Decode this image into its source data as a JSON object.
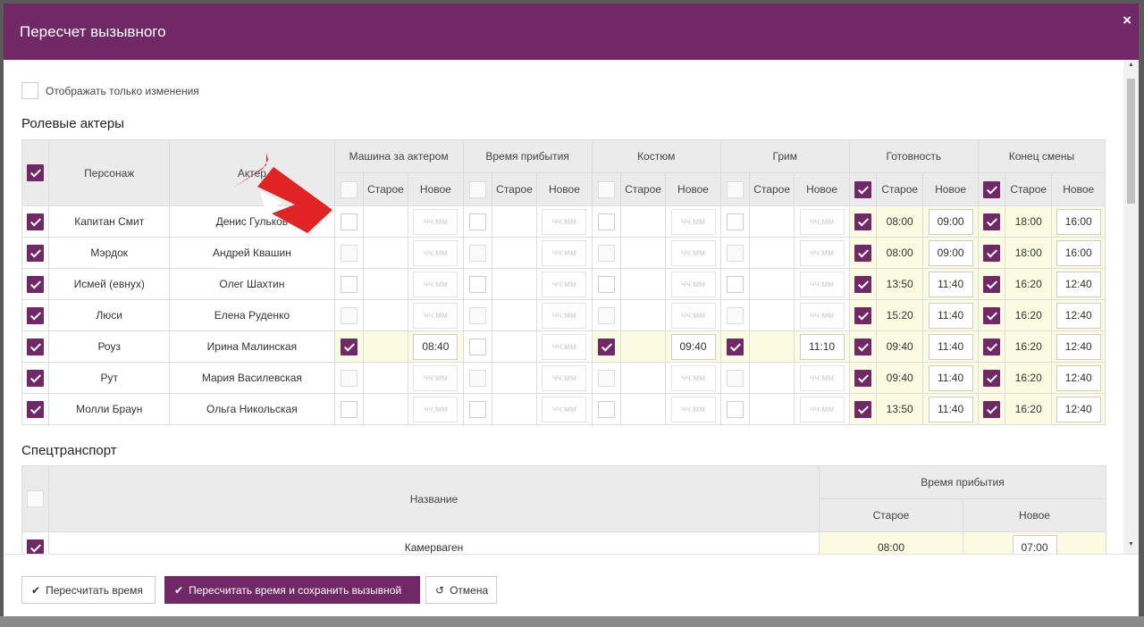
{
  "modal": {
    "title": "Пересчет вызывного",
    "close": "×"
  },
  "filters": {
    "only_changes_label": "Отображать только изменения"
  },
  "actors": {
    "section_title": "Ролевые актеры",
    "col_character": "Персонаж",
    "col_actor": "Актер",
    "groups": [
      "Машина за актером",
      "Время прибытия",
      "Костюм",
      "Грим",
      "Готовность",
      "Конец смены"
    ],
    "sub_old": "Старое",
    "sub_new": "Новое",
    "placeholder": "чч:мм",
    "rows": [
      {
        "character": "Капитан Смит",
        "actor": "Денис Гульков",
        "car": {
          "checked": false,
          "old": "",
          "new": ""
        },
        "arrival": {
          "checked": false,
          "old": "",
          "new": ""
        },
        "costume": {
          "checked": false,
          "old": "",
          "new": ""
        },
        "makeup": {
          "checked": false,
          "old": "",
          "new": ""
        },
        "ready": {
          "checked": true,
          "old": "08:00",
          "new": "09:00"
        },
        "end": {
          "checked": true,
          "old": "18:00",
          "new": "16:00"
        }
      },
      {
        "character": "Мэрдок",
        "actor": "Андрей Квашин",
        "car": {
          "checked": false,
          "old": "",
          "new": ""
        },
        "arrival": {
          "checked": false,
          "old": "",
          "new": ""
        },
        "costume": {
          "checked": false,
          "old": "",
          "new": ""
        },
        "makeup": {
          "checked": false,
          "old": "",
          "new": ""
        },
        "ready": {
          "checked": true,
          "old": "08:00",
          "new": "09:00"
        },
        "end": {
          "checked": true,
          "old": "18:00",
          "new": "16:00"
        }
      },
      {
        "character": "Исмей (евнух)",
        "actor": "Олег Шахтин",
        "car": {
          "checked": false,
          "old": "",
          "new": ""
        },
        "arrival": {
          "checked": false,
          "old": "",
          "new": ""
        },
        "costume": {
          "checked": false,
          "old": "",
          "new": ""
        },
        "makeup": {
          "checked": false,
          "old": "",
          "new": ""
        },
        "ready": {
          "checked": true,
          "old": "13:50",
          "new": "11:40"
        },
        "end": {
          "checked": true,
          "old": "16:20",
          "new": "12:40"
        }
      },
      {
        "character": "Люси",
        "actor": "Елена Руденко",
        "car": {
          "checked": false,
          "old": "",
          "new": ""
        },
        "arrival": {
          "checked": false,
          "old": "",
          "new": ""
        },
        "costume": {
          "checked": false,
          "old": "",
          "new": ""
        },
        "makeup": {
          "checked": false,
          "old": "",
          "new": ""
        },
        "ready": {
          "checked": true,
          "old": "15:20",
          "new": "11:40"
        },
        "end": {
          "checked": true,
          "old": "16:20",
          "new": "12:40"
        }
      },
      {
        "character": "Роуз",
        "actor": "Ирина Малинская",
        "car": {
          "checked": true,
          "old": "",
          "new": "08:40"
        },
        "arrival": {
          "checked": false,
          "old": "",
          "new": ""
        },
        "costume": {
          "checked": true,
          "old": "",
          "new": "09:40"
        },
        "makeup": {
          "checked": true,
          "old": "",
          "new": "11:10"
        },
        "ready": {
          "checked": true,
          "old": "09:40",
          "new": "11:40"
        },
        "end": {
          "checked": true,
          "old": "16:20",
          "new": "12:40"
        }
      },
      {
        "character": "Рут",
        "actor": "Мария Василевская",
        "car": {
          "checked": false,
          "old": "",
          "new": ""
        },
        "arrival": {
          "checked": false,
          "old": "",
          "new": ""
        },
        "costume": {
          "checked": false,
          "old": "",
          "new": ""
        },
        "makeup": {
          "checked": false,
          "old": "",
          "new": ""
        },
        "ready": {
          "checked": true,
          "old": "09:40",
          "new": "11:40"
        },
        "end": {
          "checked": true,
          "old": "16:20",
          "new": "12:40"
        }
      },
      {
        "character": "Молли Браун",
        "actor": "Ольга Никольская",
        "car": {
          "checked": false,
          "old": "",
          "new": ""
        },
        "arrival": {
          "checked": false,
          "old": "",
          "new": ""
        },
        "costume": {
          "checked": false,
          "old": "",
          "new": ""
        },
        "makeup": {
          "checked": false,
          "old": "",
          "new": ""
        },
        "ready": {
          "checked": true,
          "old": "13:50",
          "new": "11:40"
        },
        "end": {
          "checked": true,
          "old": "16:20",
          "new": "12:40"
        }
      }
    ]
  },
  "transport": {
    "section_title": "Спецтранспорт",
    "col_name": "Название",
    "col_arrival": "Время прибытия",
    "sub_old": "Старое",
    "sub_new": "Новое",
    "rows": [
      {
        "name": "Камерваген",
        "checked": true,
        "old": "08:00",
        "new": "07:00"
      }
    ]
  },
  "footer": {
    "recalc_label": "Пересчитать время",
    "recalc_save_label": "Пересчитать время и сохранить вызывной",
    "cancel_label": "Отмена"
  },
  "colors": {
    "brand": "#702866",
    "highlight": "#fbfbe1",
    "old_value": "#8b1a1a",
    "arrow": "#e02424"
  }
}
